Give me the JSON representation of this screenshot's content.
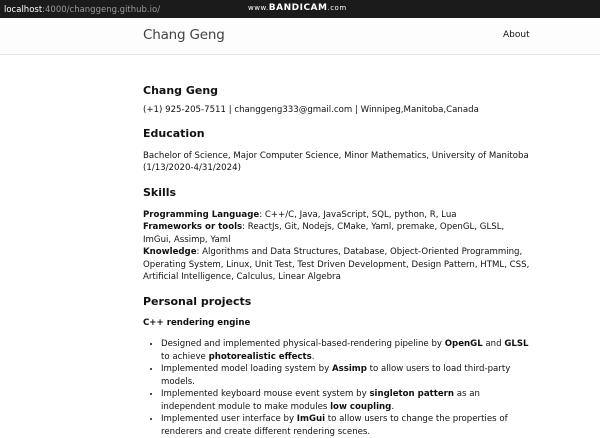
{
  "browser": {
    "url_host": "localhost",
    "url_path": ":4000/changgeng.github.io/",
    "watermark_prefix": "www.",
    "watermark_brand": "BANDICAM",
    "watermark_suffix": ".com"
  },
  "header": {
    "site_title": "Chang Geng",
    "nav_about": "About"
  },
  "profile": {
    "name": "Chang Geng",
    "contact": "(+1) 925-205-7511 | changgeng333@gmail.com | Winnipeg,Manitoba,Canada"
  },
  "education": {
    "heading": "Education",
    "text": "Bachelor of Science, Major Computer Science, Minor Mathematics, University of Manitoba (1/13/2020-4/31/2024)"
  },
  "skills": {
    "heading": "Skills",
    "lines": [
      {
        "label": "Programming Language",
        "value": ": C++/C, Java, JavaScript, SQL, python, R, Lua"
      },
      {
        "label": "Frameworks or tools",
        "value": ": ReactJs, Git, Nodejs, CMake, Yaml, premake, OpenGL, GLSL, ImGui, Assimp, Yaml"
      },
      {
        "label": "Knowledge",
        "value": ": Algorithms and Data Structures, Database, Object-Oriented Programming, Operating System, Linux, Unit Test, Test Driven Development, Design Pattern, HTML, CSS, Artificial Intelligence, Calculus, Linear Algebra"
      }
    ]
  },
  "projects": {
    "heading": "Personal projects",
    "project_title": "C++ rendering engine",
    "items": [
      {
        "a": "Designed and implemented physical-based-rendering pipeline by ",
        "b1": "OpenGL",
        "c": " and ",
        "b2": "GLSL",
        "d": " to achieve ",
        "b3": "photorealistic effects",
        "e": "."
      },
      {
        "a": "Implemented model loading system by ",
        "b1": "Assimp",
        "c": " to allow users to load third-party models."
      },
      {
        "a": "Implemented keyboard mouse event system by ",
        "b1": "singleton pattern",
        "c": " as an independent module to make modules ",
        "b2": "low coupling",
        "d": "."
      },
      {
        "a": "Implemented user interface by ",
        "b1": "ImGui",
        "c": " to allow users to change the properties of renderers and create different rendering scenes."
      }
    ]
  }
}
